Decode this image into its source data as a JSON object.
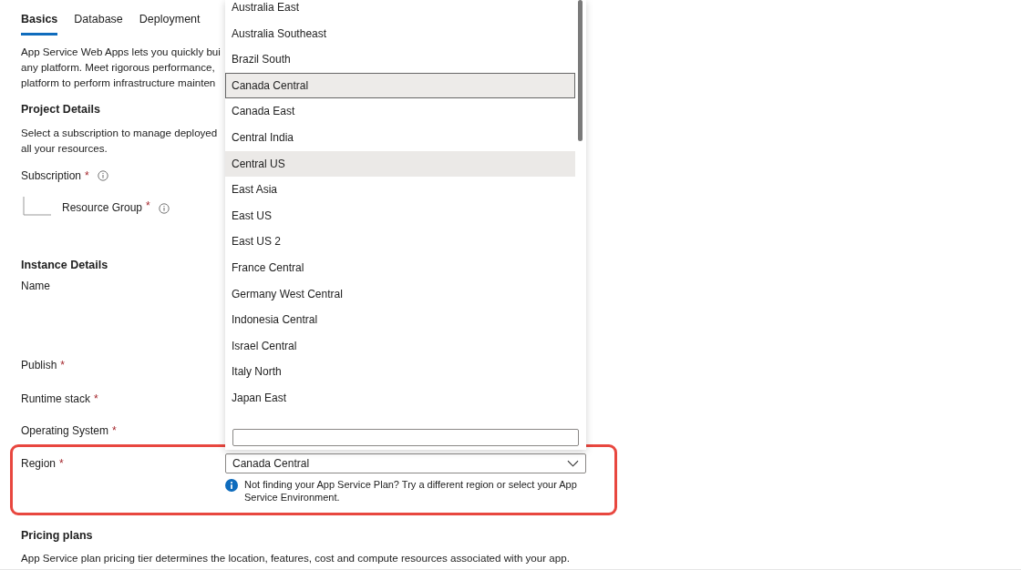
{
  "tabs": [
    {
      "label": "Basics",
      "selected": true
    },
    {
      "label": "Database",
      "selected": false
    },
    {
      "label": "Deployment",
      "selected": false
    }
  ],
  "intro_lines": [
    "App Service Web Apps lets you quickly bui",
    "any platform. Meet rigorous performance,",
    "platform to perform infrastructure mainten"
  ],
  "project_details": {
    "title": "Project Details",
    "description_lines": [
      "Select a subscription to manage deployed",
      "all your resources."
    ],
    "fields": [
      {
        "label": "Subscription",
        "required_mark": "*",
        "info": true,
        "children": [
          {
            "label": "Resource Group",
            "required_mark": "*",
            "info": true
          }
        ]
      }
    ]
  },
  "instance_details": {
    "title": "Instance Details",
    "fields": [
      {
        "label": "Name"
      },
      {
        "label": "Publish",
        "required_mark": "*"
      },
      {
        "label": "Runtime stack",
        "required_mark": "*"
      },
      {
        "label": "Operating System",
        "required_mark": "*"
      }
    ]
  },
  "region": {
    "label": "Region",
    "required_mark": "*",
    "value": "Canada Central",
    "message": "Not finding your App Service Plan? Try a different region or select your App Service Environment."
  },
  "dropdown": {
    "items": [
      {
        "label": "Australia East",
        "selected": false,
        "hovered": false
      },
      {
        "label": "Australia Southeast",
        "selected": false,
        "hovered": false
      },
      {
        "label": "Brazil South",
        "selected": false,
        "hovered": false
      },
      {
        "label": "Canada Central",
        "selected": true,
        "hovered": false
      },
      {
        "label": "Canada East",
        "selected": false,
        "hovered": false
      },
      {
        "label": "Central India",
        "selected": false,
        "hovered": false
      },
      {
        "label": "Central US",
        "selected": false,
        "hovered": true
      },
      {
        "label": "East Asia",
        "selected": false,
        "hovered": false
      },
      {
        "label": "East US",
        "selected": false,
        "hovered": false
      },
      {
        "label": "East US 2",
        "selected": false,
        "hovered": false
      },
      {
        "label": "France Central",
        "selected": false,
        "hovered": false
      },
      {
        "label": "Germany West Central",
        "selected": false,
        "hovered": false
      },
      {
        "label": "Indonesia Central",
        "selected": false,
        "hovered": false
      },
      {
        "label": "Israel Central",
        "selected": false,
        "hovered": false
      },
      {
        "label": "Italy North",
        "selected": false,
        "hovered": false
      },
      {
        "label": "Japan East",
        "selected": false,
        "hovered": false
      }
    ]
  },
  "pricing": {
    "title": "Pricing plans",
    "description": "App Service plan pricing tier determines the location, features, cost and compute resources associated with your app."
  }
}
